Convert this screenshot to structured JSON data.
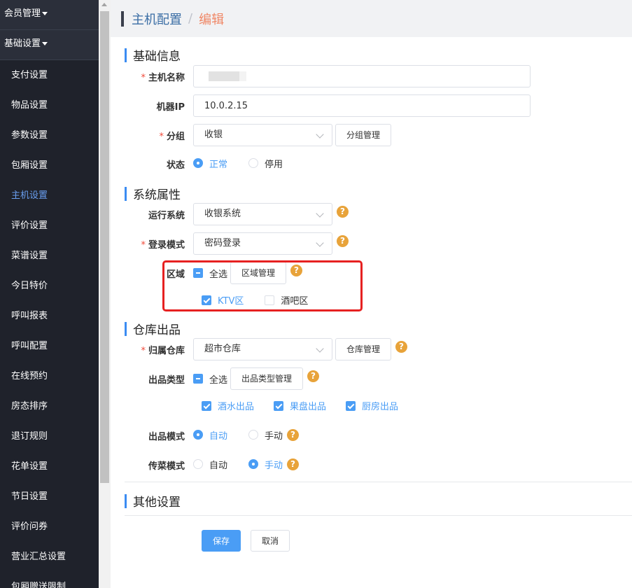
{
  "sidebar": {
    "groups": [
      {
        "label": "会员管理"
      },
      {
        "label": "基础设置"
      }
    ],
    "items": [
      {
        "label": "支付设置"
      },
      {
        "label": "物品设置"
      },
      {
        "label": "参数设置"
      },
      {
        "label": "包厢设置"
      },
      {
        "label": "主机设置"
      },
      {
        "label": "评价设置"
      },
      {
        "label": "菜谱设置"
      },
      {
        "label": "今日特价"
      },
      {
        "label": "呼叫报表"
      },
      {
        "label": "呼叫配置"
      },
      {
        "label": "在线预约"
      },
      {
        "label": "房态排序"
      },
      {
        "label": "退订规则"
      },
      {
        "label": "花单设置"
      },
      {
        "label": "节日设置"
      },
      {
        "label": "评价问券"
      },
      {
        "label": "营业汇总设置"
      },
      {
        "label": "包厢赠送限制"
      }
    ],
    "active_item": "主机设置"
  },
  "breadcrumb": {
    "parent": "主机配置",
    "separator": "/",
    "current": "编辑"
  },
  "sections": {
    "basic": "基础信息",
    "system": "系统属性",
    "warehouse": "仓库出品",
    "other": "其他设置"
  },
  "basic": {
    "host_name_label": "主机名称",
    "ip_label": "机器IP",
    "ip_value": "10.0.2.15",
    "group_label": "分组",
    "group_value": "收银",
    "group_manage_button": "分组管理",
    "status_label": "状态",
    "status_options": [
      "正常",
      "停用"
    ]
  },
  "system": {
    "os_label": "运行系统",
    "os_value": "收银系统",
    "login_label": "登录模式",
    "login_value": "密码登录",
    "area_label": "区域",
    "select_all": "全选",
    "area_manage_button": "区域管理",
    "areas": [
      "KTV区",
      "酒吧区"
    ]
  },
  "warehouse": {
    "warehouse_label": "归属仓库",
    "warehouse_value": "超市仓库",
    "warehouse_manage_button": "仓库管理",
    "output_type_label": "出品类型",
    "select_all": "全选",
    "output_type_manage_button": "出品类型管理",
    "output_types": [
      "酒水出品",
      "果盘出品",
      "厨房出品"
    ],
    "output_mode_label": "出品模式",
    "output_mode_options": [
      "自动",
      "手动"
    ],
    "serve_mode_label": "传菜模式",
    "serve_mode_options": [
      "自动",
      "手动"
    ]
  },
  "actions": {
    "save": "保存",
    "cancel": "取消"
  },
  "help_glyph": "?",
  "colors": {
    "sidebar_bg": "#2b2f3a",
    "active_text": "#6a9ff0",
    "primary": "#4a9df5",
    "help_badge": "#e8a33a",
    "highlight_border": "#e62121",
    "breadcrumb_current": "#f08766"
  }
}
